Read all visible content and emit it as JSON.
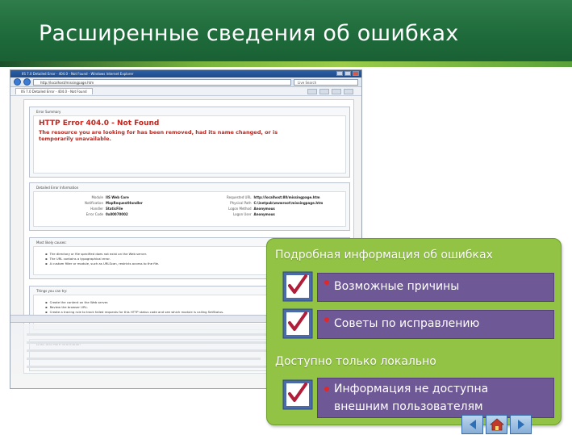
{
  "slide": {
    "title": "Расширенные сведения об ошибках"
  },
  "browser": {
    "window_title": "IIS 7.0 Detailed Error - 404.0 - Not Found - Windows Internet Explorer",
    "url": "http://localhost/missingpage.htm",
    "search_placeholder": "Live Search",
    "tab_label": "IIS 7.0 Detailed Error - 404.0 - Not Found",
    "error_summary_title": "Error Summary",
    "error_heading": "HTTP Error 404.0 - Not Found",
    "error_message": "The resource you are looking for has been removed, had its name changed, or is temporarily unavailable.",
    "detailed_title": "Detailed Error Information",
    "details": [
      {
        "label": "Module",
        "value": "IIS Web Core",
        "label2": "Requested URL",
        "value2": "http://localhost:80/missingpage.htm"
      },
      {
        "label": "Notification",
        "value": "MapRequestHandler",
        "label2": "Physical Path",
        "value2": "C:\\inetpub\\wwwroot\\missingpage.htm"
      },
      {
        "label": "Handler",
        "value": "StaticFile",
        "label2": "Logon Method",
        "value2": "Anonymous"
      },
      {
        "label": "Error Code",
        "value": "0x80070002",
        "label2": "Logon User",
        "value2": "Anonymous"
      }
    ],
    "causes_title": "Most likely causes:",
    "causes": [
      "The directory or file specified does not exist on the Web server.",
      "The URL contains a typographical error.",
      "A custom filter or module, such as URLScan, restricts access to the file."
    ],
    "tryit_title": "Things you can try:",
    "tryit": [
      "Create the content on the Web server.",
      "Review the browser URL.",
      "Create a tracing rule to track failed requests for this HTTP status code and see which module is calling SetStatus.",
      "tracing for failed requests, click here."
    ],
    "links_title": "Links and More Information"
  },
  "callout": {
    "heading1": "Подробная информация об ошибках",
    "item1": "Возможные причины",
    "item2": "Советы по исправлению",
    "heading2": "Доступно только локально",
    "item3": "Информация не доступна внешним пользователям"
  },
  "colors": {
    "header_green": "#1e6a3a",
    "callout_green": "#92c345",
    "item_purple": "#6f5896",
    "error_red": "#c4221a"
  }
}
